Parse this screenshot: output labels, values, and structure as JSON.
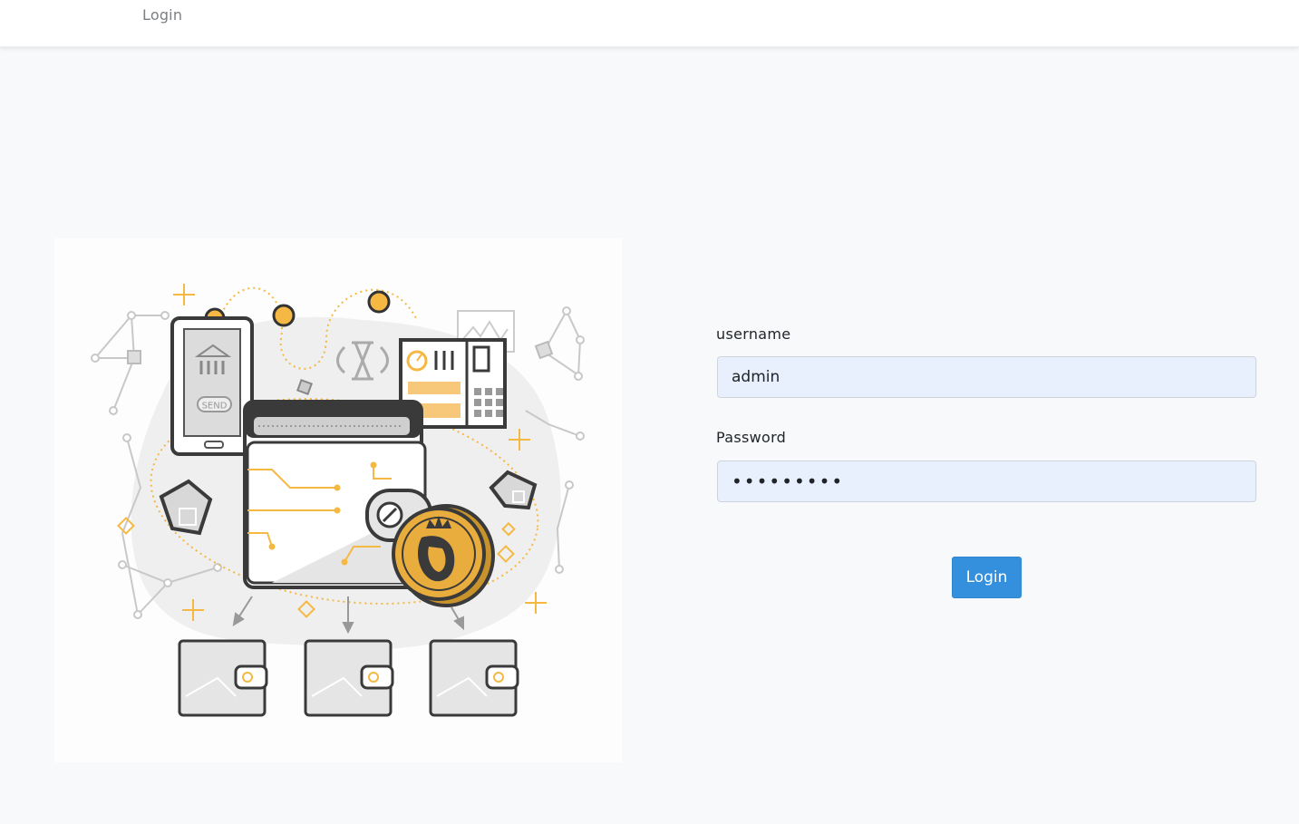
{
  "nav": {
    "login_link": "Login"
  },
  "form": {
    "username_label": "username",
    "username_value": "admin",
    "password_label": "Password",
    "password_value": "•••••••••",
    "submit_label": "Login"
  },
  "illustration": {
    "phone_label": "SEND"
  },
  "colors": {
    "accent": "#3490dc",
    "input_bg": "#e8f0fe",
    "gold": "#f5b842",
    "page_bg": "#f8f9fa"
  }
}
